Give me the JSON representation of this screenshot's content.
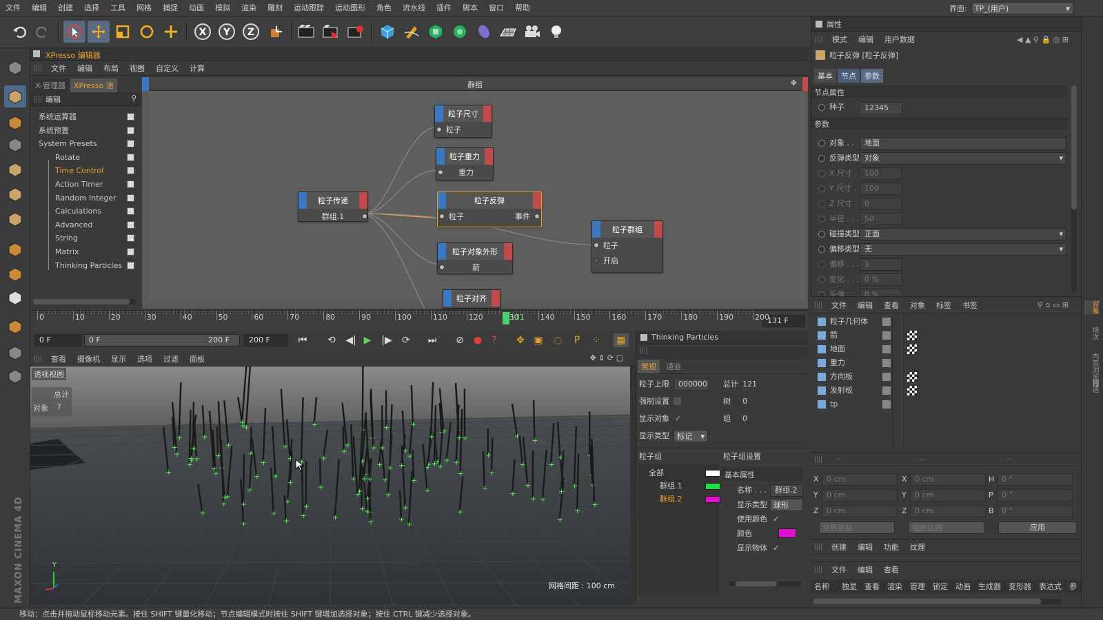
{
  "menu": [
    "文件",
    "编辑",
    "创建",
    "选择",
    "工具",
    "网格",
    "捕捉",
    "动画",
    "模拟",
    "渲染",
    "雕刻",
    "运动跟踪",
    "运动图形",
    "角色",
    "流水线",
    "插件",
    "脚本",
    "窗口",
    "帮助"
  ],
  "layout": {
    "label": "界面:",
    "value": "TP_(用户)"
  },
  "xpresso": {
    "title": "XPresso 编辑器",
    "menu": [
      "文件",
      "编辑",
      "布局",
      "视图",
      "自定义",
      "计算"
    ],
    "tabs": [
      "X-管理器",
      "XPresso 池"
    ],
    "pool_header": "编辑",
    "canvas_title": "群组"
  },
  "pool": [
    {
      "label": "系统运算器",
      "indent": 0
    },
    {
      "label": "系统预置",
      "indent": 0
    },
    {
      "label": "System Presets",
      "indent": 0
    },
    {
      "label": "Rotate",
      "indent": 1
    },
    {
      "label": "Time Control",
      "indent": 1,
      "highlight": true
    },
    {
      "label": "Action Timer",
      "indent": 1
    },
    {
      "label": "Random Integer",
      "indent": 1
    },
    {
      "label": "Calculations",
      "indent": 1
    },
    {
      "label": "Advanced",
      "indent": 1
    },
    {
      "label": "String",
      "indent": 1
    },
    {
      "label": "Matrix",
      "indent": 1
    },
    {
      "label": "Thinking Particles",
      "indent": 1
    }
  ],
  "nodes": {
    "pass": {
      "title": "粒子传递",
      "port": "群组.1"
    },
    "size": {
      "title": "粒子尺寸",
      "port": "粒子"
    },
    "gravity": {
      "title": "粒子重力",
      "port": "重力"
    },
    "bounce": {
      "title": "粒子反弹",
      "port_in": "粒子",
      "port_out": "事件"
    },
    "shape": {
      "title": "粒子对象外形",
      "port": "箭"
    },
    "group": {
      "title": "粒子群组",
      "port1": "粒子",
      "port2": "开启"
    },
    "partial": {
      "title": "粒子对齐"
    }
  },
  "timeline": {
    "ticks": [
      "0",
      "10",
      "20",
      "30",
      "40",
      "50",
      "60",
      "70",
      "80",
      "90",
      "100",
      "110",
      "120",
      "130",
      "140",
      "150",
      "160",
      "170",
      "180",
      "190",
      "200"
    ],
    "current": "131",
    "current_field": "131 F",
    "start": "0 F",
    "range_start": "0 F",
    "range_end": "200 F",
    "end": "200 F"
  },
  "viewport": {
    "menu": [
      "查看",
      "摄像机",
      "显示",
      "选项",
      "过滤",
      "面板"
    ],
    "label": "透视视图",
    "stat_total": "总计",
    "stat_obj_label": "对象",
    "stat_obj_value": "7",
    "grid": "网格间距 : 100 cm",
    "axis_y": "Y"
  },
  "tp": {
    "title": "Thinking Particles",
    "tabs": [
      "常规",
      "通道"
    ],
    "limit_label": "粒子上限",
    "limit_value": "000000",
    "total_label": "总计",
    "total_value": "121",
    "force_label": "强制设置",
    "tree_label": "树",
    "tree_value": "0",
    "show_obj_label": "显示对象",
    "group_label": "组",
    "group_value": "0",
    "show_type_label": "显示类型",
    "show_type_value": "标记",
    "groups_header": "粒子组",
    "settings_header": "粒子组设置",
    "groups": [
      {
        "name": "全部",
        "color": "#ffffff"
      },
      {
        "name": "群组.1",
        "color": "#22dd44"
      },
      {
        "name": "群组.2",
        "color": "#e010d0"
      }
    ],
    "basic_header": "基本属性",
    "name_label": "名称 . . .",
    "name_value": "群组.2",
    "dtype_label": "显示类型",
    "dtype_value": "球形",
    "use_color_label": "使用颜色",
    "color_label": "颜色",
    "color_value": "#e010d0",
    "show_obj2_label": "显示物体"
  },
  "attr": {
    "header": "属性",
    "menu": [
      "模式",
      "编辑",
      "用户数据"
    ],
    "object": "粒子反弹 [粒子反弹]",
    "tabs": [
      "基本",
      "节点",
      "参数"
    ],
    "node_props": "节点属性",
    "seed_label": "种子",
    "seed_value": "12345",
    "params": "参数",
    "rows": [
      {
        "label": "对象 . .",
        "value": "地面",
        "dim": false,
        "wide": true
      },
      {
        "label": "反弹类型",
        "value": "对象",
        "dim": false,
        "wide": true,
        "dropdown": true
      },
      {
        "label": "X 尺寸 . .",
        "value": "100",
        "dim": true
      },
      {
        "label": "Y 尺寸 . .",
        "value": "100",
        "dim": true
      },
      {
        "label": "Z 尺寸 . .",
        "value": "0",
        "dim": true
      },
      {
        "label": "半径 . . .",
        "value": "50",
        "dim": true
      },
      {
        "label": "碰撞类型",
        "value": "正面",
        "dim": false,
        "wide": true,
        "dropdown": true
      },
      {
        "label": "偏移类型",
        "value": "无",
        "dim": false,
        "wide": true,
        "dropdown": true
      },
      {
        "label": "偏移 . . .",
        "value": "1",
        "dim": true
      },
      {
        "label": "变化 . . .",
        "value": "0 %",
        "dim": true
      },
      {
        "label": "反弹 . . .",
        "value": "0 %",
        "dim": true
      }
    ]
  },
  "objects": {
    "menu": [
      "文件",
      "编辑",
      "查看",
      "对象",
      "标签",
      "书签"
    ],
    "items": [
      "粒子几何体",
      "箭",
      "地面",
      "重力",
      "方向板",
      "发射板",
      "tp"
    ]
  },
  "coords": {
    "headers": [
      "--",
      "--",
      "--"
    ],
    "rows": [
      [
        "X",
        "0 cm",
        "X",
        "0 cm",
        "H",
        "0 °"
      ],
      [
        "Y",
        "0 cm",
        "Y",
        "0 cm",
        "P",
        "0 °"
      ],
      [
        "Z",
        "0 cm",
        "Z",
        "0 cm",
        "B",
        "0 °"
      ]
    ],
    "world": "世界坐标",
    "scale": "缩放比例",
    "apply": "应用"
  },
  "layers": {
    "menu": [
      "创建",
      "编辑",
      "功能",
      "纹理"
    ],
    "menu2": [
      "文件",
      "编辑",
      "查看"
    ],
    "cols": [
      "名称",
      "独显",
      "查看",
      "渲染",
      "管理",
      "锁定",
      "动画",
      "生成器",
      "变形器",
      "表达式",
      "参"
    ]
  },
  "status": "移动：点击并拖动鼠标移动元素。按住 SHIFT 键量化移动；节点编辑模式时按住 SHIFT 键增加选择对象；按住 CTRL 键减少选择对象。",
  "brand": "MAXON CINEMA 4D",
  "right_tabs": [
    "对象",
    "场次",
    "内容浏览器",
    "构造"
  ]
}
